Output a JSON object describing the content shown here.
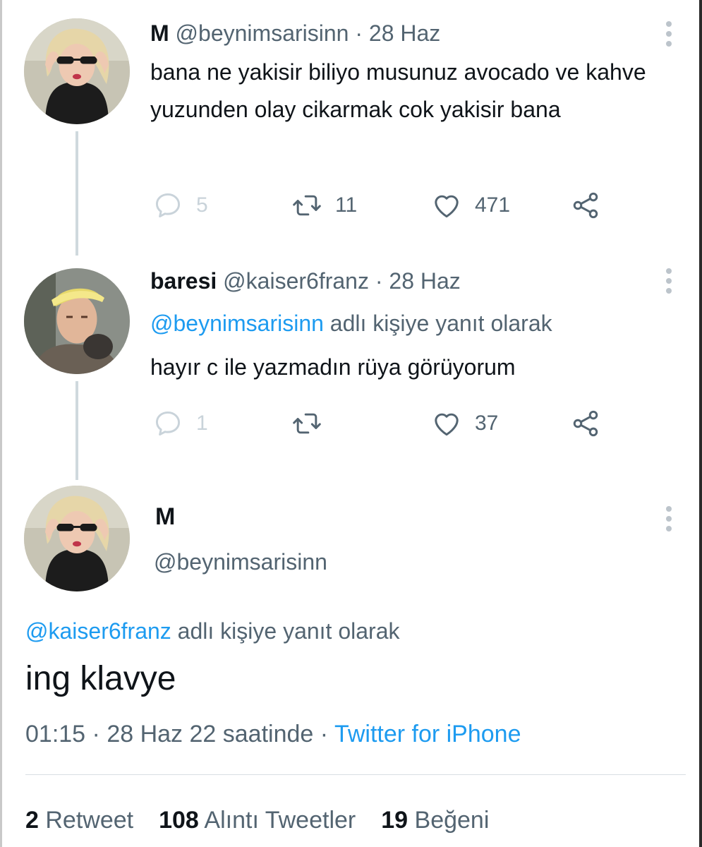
{
  "tweets": [
    {
      "name": "M",
      "handle": "@beynimsarisinn",
      "separator": "·",
      "date": "28 Haz",
      "text": "bana ne yakisir biliyo musunuz avocado ve kahve yuzunden olay cikarmak cok yakisir bana",
      "replies": "5",
      "retweets": "11",
      "likes": "471"
    },
    {
      "name": "baresi",
      "handle": "@kaiser6franz",
      "separator": "·",
      "date": "28 Haz",
      "reply_to_handle": "@beynimsarisinn",
      "reply_to_suffix": " adlı kişiye yanıt olarak",
      "text": "hayır c ile yazmadın rüya görüyorum",
      "replies": "1",
      "retweets": "",
      "likes": "37"
    }
  ],
  "main_tweet": {
    "name": "M",
    "handle": "@beynimsarisinn",
    "reply_to_handle": "@kaiser6franz",
    "reply_to_suffix": " adlı kişiye yanıt olarak",
    "text": "ing klavye",
    "time": "01:15",
    "separator": "·",
    "date_text": "28 Haz 22 saatinde",
    "source": "Twitter for iPhone",
    "retweet_count": "2",
    "retweet_label": "Retweet",
    "quote_count": "108",
    "quote_label": "Alıntı Tweetler",
    "like_count": "19",
    "like_label": "Beğeni"
  },
  "icons": {
    "reply": "reply-icon",
    "retweet": "retweet-icon",
    "like": "heart-icon",
    "share": "share-icon",
    "more": "more-vertical-icon"
  },
  "colors": {
    "link": "#1d9bf0",
    "secondary_text": "#536471",
    "thread_line": "#cfd9de"
  }
}
